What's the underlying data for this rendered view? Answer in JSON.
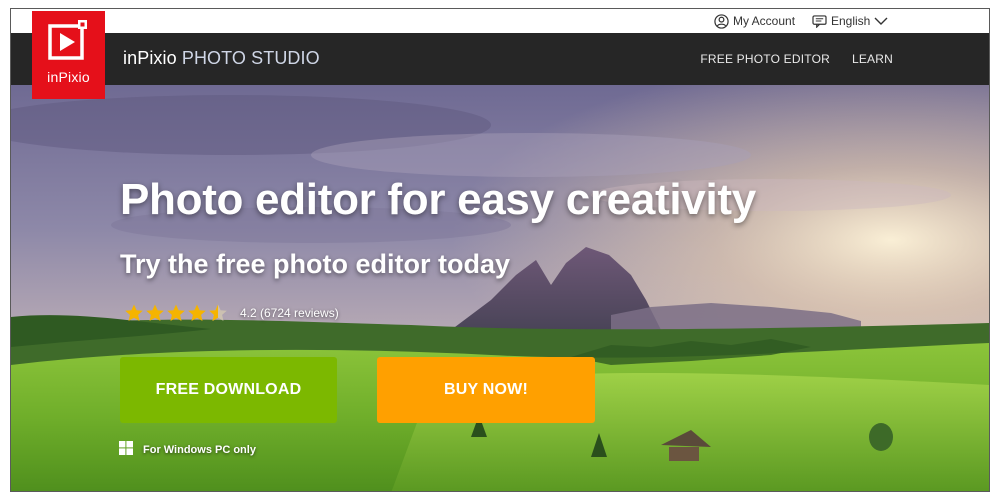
{
  "utility_bar": {
    "account_label": "My Account",
    "language_label": "English"
  },
  "logo": {
    "text": "inPixio",
    "color": "#e5101a"
  },
  "navbar": {
    "brand": "inPixio",
    "product": "PHOTO STUDIO",
    "links": [
      {
        "label": "FREE PHOTO EDITOR"
      },
      {
        "label": "LEARN"
      }
    ]
  },
  "hero": {
    "headline": "Photo editor for easy creativity",
    "subheadline": "Try the free photo editor today",
    "rating": {
      "stars": 4.5,
      "max_stars": 5,
      "text": "4.2 (6724 reviews)"
    },
    "buttons": {
      "download_label": "FREE DOWNLOAD",
      "buy_label": "BUY NOW!"
    },
    "platform_note": "For Windows PC only"
  },
  "colors": {
    "navbar_bg": "#262626",
    "download_button": "#7cb800",
    "buy_button": "#ffa000",
    "star": "#f5b400"
  }
}
